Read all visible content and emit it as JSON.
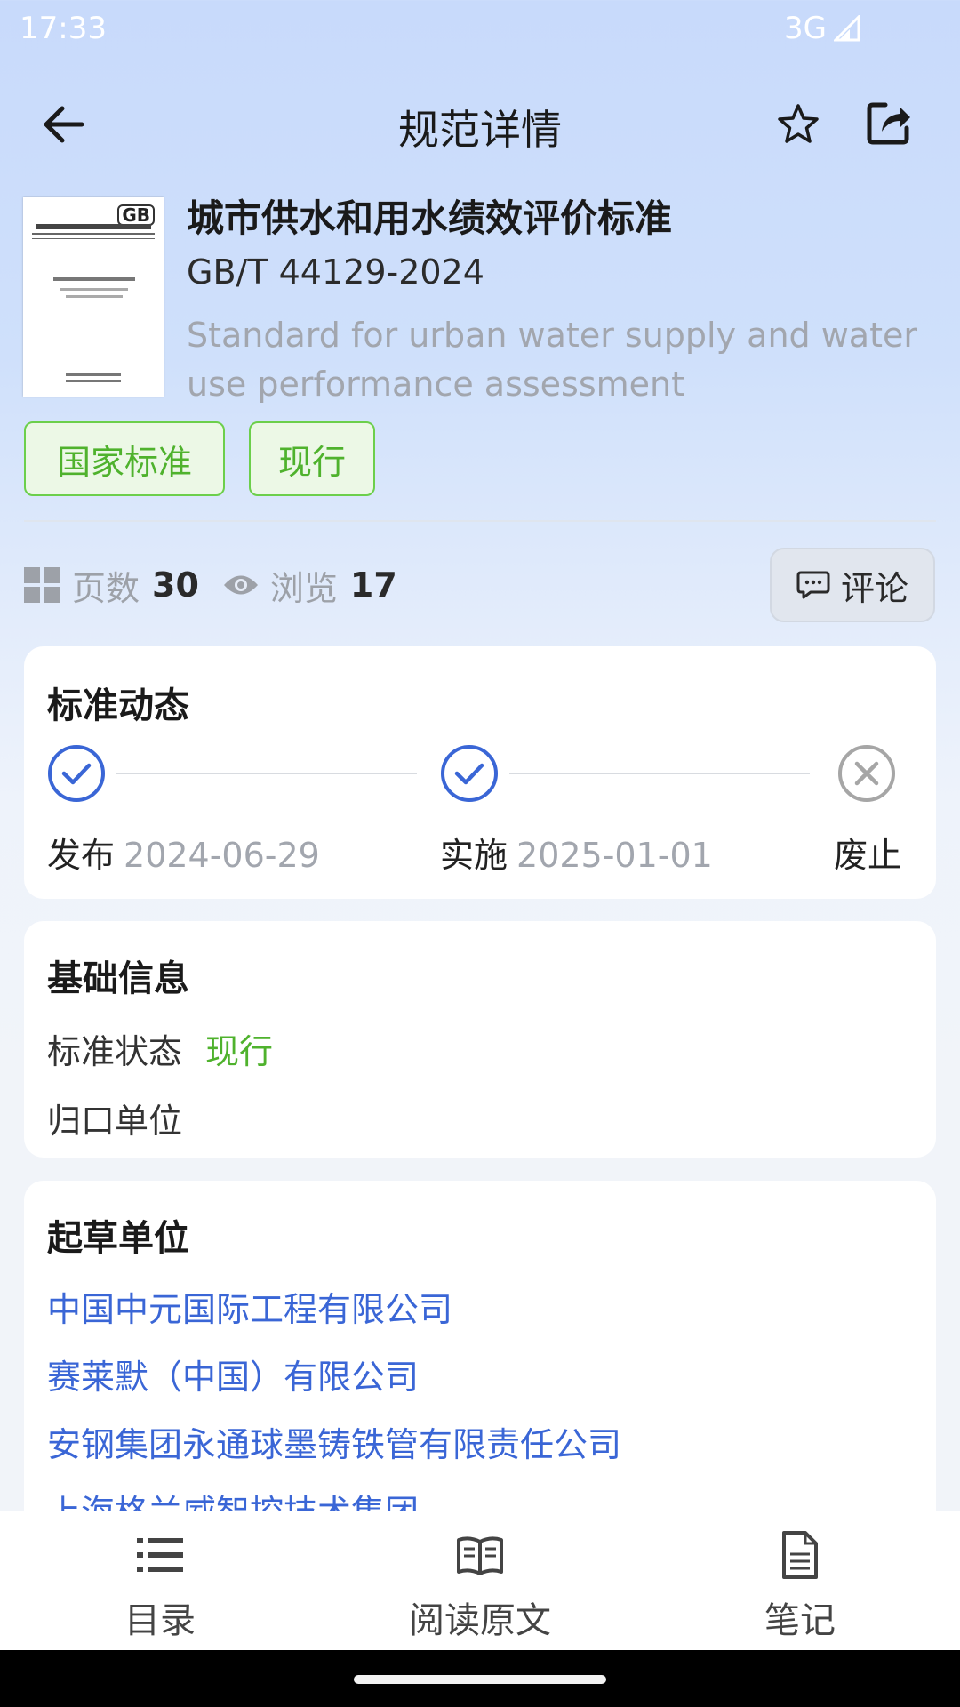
{
  "status_bar": {
    "time": "17:33",
    "network": "3G"
  },
  "app_bar": {
    "title": "规范详情"
  },
  "standard": {
    "title": "城市供水和用水绩效评价标准",
    "code": "GB/T 44129-2024",
    "english_title": "Standard for urban water supply and water use performance assessment",
    "tags": [
      "国家标准",
      "现行"
    ]
  },
  "stats": {
    "pages_label": "页数",
    "pages_value": "30",
    "views_label": "浏览",
    "views_value": "17",
    "comment_label": "评论"
  },
  "timeline": {
    "title": "标准动态",
    "steps": [
      {
        "label": "发布",
        "date": "2024-06-29",
        "status": "done"
      },
      {
        "label": "实施",
        "date": "2025-01-01",
        "status": "done"
      },
      {
        "label": "废止",
        "date": "",
        "status": "not-applicable"
      }
    ]
  },
  "basic_info": {
    "title": "基础信息",
    "status_label": "标准状态",
    "status_value": "现行",
    "authority_label": "归口单位"
  },
  "drafters": {
    "title": "起草单位",
    "items": [
      "中国中元国际工程有限公司",
      "赛莱默（中国）有限公司",
      "安钢集团永通球墨铸铁管有限责任公司",
      "上海格兰威智控技术集团"
    ]
  },
  "bottom_nav": {
    "items": [
      {
        "label": "目录",
        "icon": "list-icon"
      },
      {
        "label": "阅读原文",
        "icon": "book-icon"
      },
      {
        "label": "笔记",
        "icon": "note-icon"
      }
    ]
  },
  "colors": {
    "accent_blue": "#3a66d6",
    "tag_green": "#4fb22d",
    "muted_gray": "#a2a6ae"
  }
}
